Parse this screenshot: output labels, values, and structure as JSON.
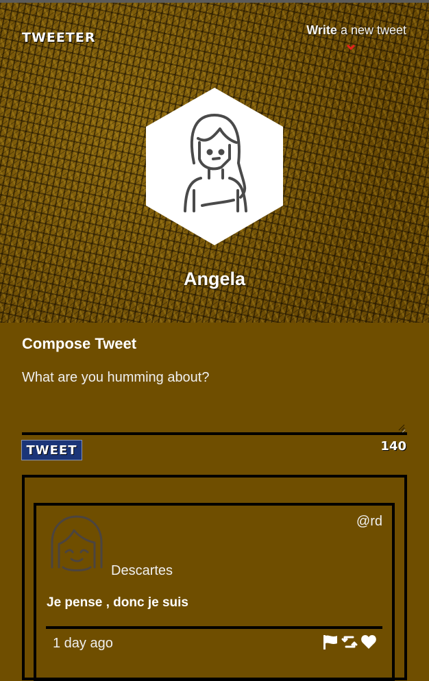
{
  "nav": {
    "logo": "TWEETER",
    "write_strong": "Write",
    "write_rest": " a new tweet",
    "chevron_icon": "chevron-down-icon"
  },
  "profile": {
    "name": "Angela",
    "avatar_icon": "user-avatar-icon"
  },
  "compose": {
    "title": "Compose Tweet",
    "placeholder": "What are you humming about?",
    "value": "",
    "button_label": "TWEET",
    "counter": "140"
  },
  "feed": {
    "tweets": [
      {
        "author": "Descartes",
        "handle": "@rd",
        "text": "Je pense , donc je suis",
        "time": "1 day ago",
        "actions": [
          "flag-icon",
          "retweet-icon",
          "heart-icon"
        ]
      }
    ]
  },
  "colors": {
    "page_bg": "#6f4e00",
    "header_texture": "#7d5a08",
    "button_bg": "#1b3578",
    "chevron": "#e8221e",
    "text": "#ffffff"
  }
}
